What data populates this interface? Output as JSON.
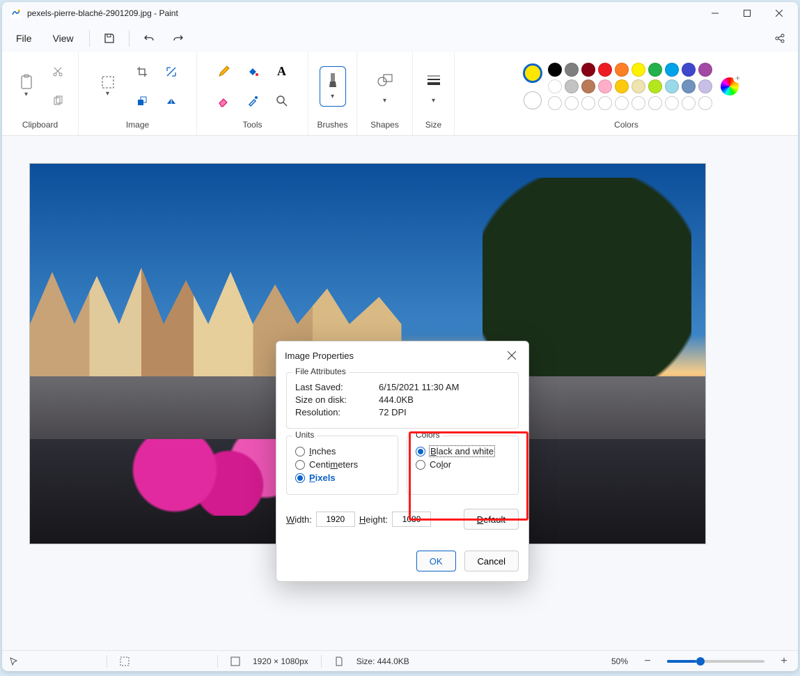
{
  "title": "pexels-pierre-blaché-2901209.jpg - Paint",
  "menus": {
    "file": "File",
    "view": "View"
  },
  "ribbon": {
    "clipboard": "Clipboard",
    "image": "Image",
    "tools": "Tools",
    "brushes": "Brushes",
    "shapes": "Shapes",
    "size": "Size",
    "colors": "Colors"
  },
  "palette": {
    "row1": [
      "#000000",
      "#7f7f7f",
      "#880016",
      "#ed1c24",
      "#ff7f27",
      "#fff200",
      "#22b14c",
      "#00a2e8",
      "#3f48cc",
      "#a349a4"
    ],
    "row2": [
      "#ffffff",
      "#c3c3c3",
      "#b97a57",
      "#ffaec9",
      "#ffc90e",
      "#efe4b0",
      "#b5e61d",
      "#99d9ea",
      "#7092be",
      "#c8bfe7"
    ]
  },
  "dialog": {
    "title": "Image Properties",
    "fileattr_legend": "File Attributes",
    "last_saved_label": "Last Saved:",
    "last_saved_value": "6/15/2021 11:30 AM",
    "size_label": "Size on disk:",
    "size_value": "444.0KB",
    "res_label": "Resolution:",
    "res_value": "72 DPI",
    "units_legend": "Units",
    "units_inches": "Inches",
    "units_cm": "Centimeters",
    "units_px": "Pixels",
    "colors_legend": "Colors",
    "colors_bw": "Black and white",
    "colors_color": "Color",
    "width_label": "Width:",
    "width_value": "1920",
    "height_label": "Height:",
    "height_value": "1080",
    "default": "Default",
    "ok": "OK",
    "cancel": "Cancel"
  },
  "status": {
    "dims": "1920 × 1080px",
    "size": "Size: 444.0KB",
    "zoom": "50%"
  }
}
